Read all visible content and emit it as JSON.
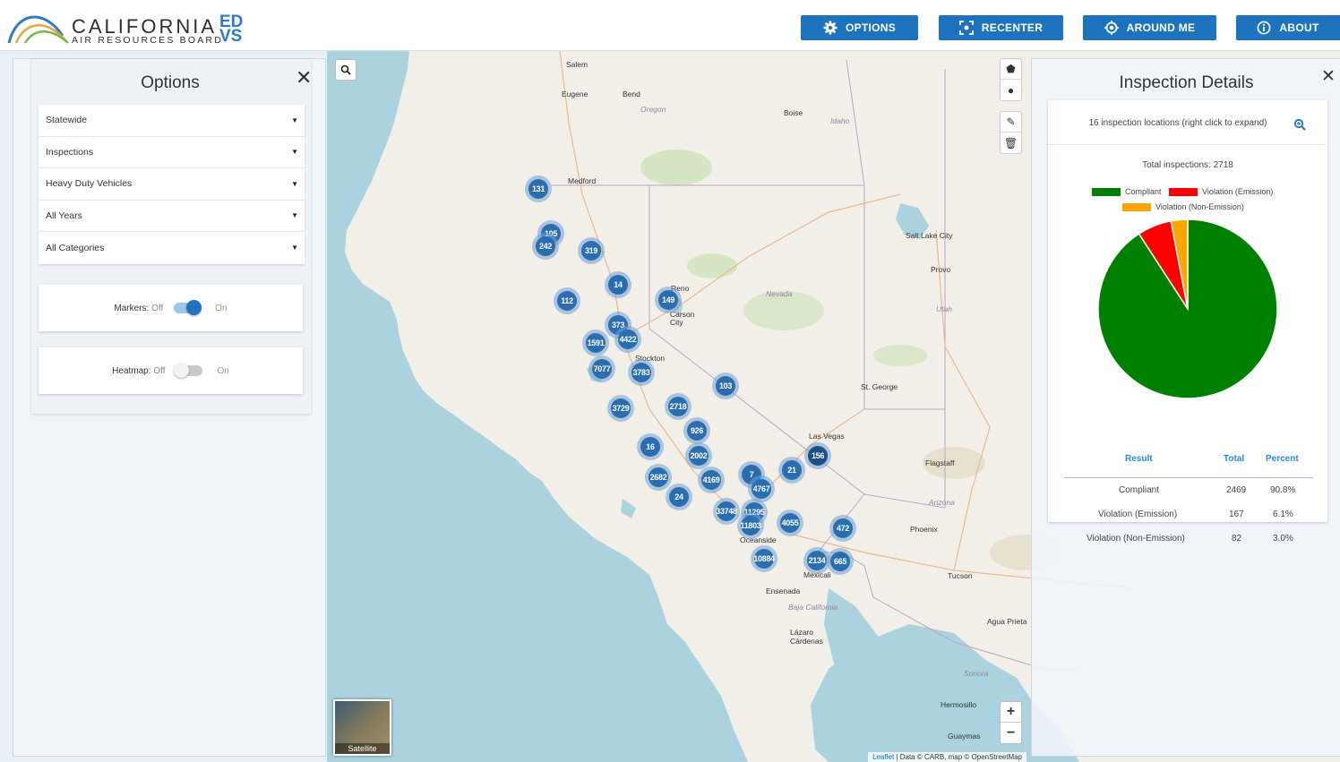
{
  "logo": {
    "main": "CALIFORNIA",
    "sub": "AIR RESOURCES BOARD",
    "edvs": "ED VS"
  },
  "nav": [
    {
      "label": "OPTIONS",
      "icon": "gear-icon"
    },
    {
      "label": "RECENTER",
      "icon": "recenter-icon"
    },
    {
      "label": "AROUND ME",
      "icon": "location-target-icon"
    },
    {
      "label": "ABOUT",
      "icon": "info-icon"
    }
  ],
  "options": {
    "title": "Options",
    "selects": [
      "Statewide",
      "Inspections",
      "Heavy Duty Vehicles",
      "All Years",
      "All Categories"
    ],
    "markers": {
      "label": "Markers:",
      "off": "Off",
      "on": "On",
      "enabled": true
    },
    "heatmap": {
      "label": "Heatmap:",
      "off": "Off",
      "on": "On",
      "enabled": false
    }
  },
  "map": {
    "labels": [
      {
        "text": "Salem"
      },
      {
        "text": "Eugene"
      },
      {
        "text": "Bend"
      },
      {
        "text": "Oregon",
        "state": true
      },
      {
        "text": "Boise"
      },
      {
        "text": "Idaho",
        "state": true
      },
      {
        "text": "Medford"
      },
      {
        "text": "Salt Lake City"
      },
      {
        "text": "Provo"
      },
      {
        "text": "Nevada",
        "state": true
      },
      {
        "text": "Utah",
        "state": true
      },
      {
        "text": "Reno"
      },
      {
        "text": "Carson City"
      },
      {
        "text": "Stockton"
      },
      {
        "text": "St. George"
      },
      {
        "text": "Las Vegas"
      },
      {
        "text": "Flagstaff"
      },
      {
        "text": "Arizona",
        "state": true
      },
      {
        "text": "Phoenix"
      },
      {
        "text": "Tucson"
      },
      {
        "text": "Oceanside"
      },
      {
        "text": "Mexicali"
      },
      {
        "text": "Ensenada"
      },
      {
        "text": "Baja California",
        "state": true
      },
      {
        "text": "Agua Prieta"
      },
      {
        "text": "Lázaro Cárdenas"
      },
      {
        "text": "Sonora",
        "state": true
      },
      {
        "text": "Hermosillo"
      },
      {
        "text": "Guaymas"
      }
    ],
    "clusters": [
      {
        "count": "131"
      },
      {
        "count": "105"
      },
      {
        "count": "242"
      },
      {
        "count": "319"
      },
      {
        "count": "14"
      },
      {
        "count": "149"
      },
      {
        "count": "112"
      },
      {
        "count": "373"
      },
      {
        "count": "4422"
      },
      {
        "count": "1591"
      },
      {
        "count": "7077"
      },
      {
        "count": "3783"
      },
      {
        "count": "103"
      },
      {
        "count": "3729"
      },
      {
        "count": "2718"
      },
      {
        "count": "926"
      },
      {
        "count": "16"
      },
      {
        "count": "2002"
      },
      {
        "count": "156",
        "dark": true
      },
      {
        "count": "21"
      },
      {
        "count": "7"
      },
      {
        "count": "2682"
      },
      {
        "count": "4169"
      },
      {
        "count": "4767"
      },
      {
        "count": "24"
      },
      {
        "count": "33748"
      },
      {
        "count": "11295"
      },
      {
        "count": "11803"
      },
      {
        "count": "4055"
      },
      {
        "count": "472"
      },
      {
        "count": "10884"
      },
      {
        "count": "2134"
      },
      {
        "count": "665"
      }
    ],
    "satellite_label": "Satellite",
    "attribution_leaflet": "Leaflet",
    "attribution_rest": " | Data © CARB, map © OpenStreetMap"
  },
  "inspection": {
    "title": "Inspection Details",
    "locations_text": "16 inspection locations (right click to expand)",
    "total_text": "Total inspections: 2718",
    "legend": [
      {
        "label": "Compliant",
        "color": "#008000"
      },
      {
        "label": "Violation (Emission)",
        "color": "#ff0000"
      },
      {
        "label": "Violation (Non-Emission)",
        "color": "#ffa500"
      }
    ],
    "headers": {
      "result": "Result",
      "total": "Total",
      "percent": "Percent"
    },
    "rows": [
      {
        "result": "Compliant",
        "total": "2469",
        "percent": "90.8%"
      },
      {
        "result": "Violation (Emission)",
        "total": "167",
        "percent": "6.1%"
      },
      {
        "result": "Violation (Non-Emission)",
        "total": "82",
        "percent": "3.0%"
      }
    ]
  },
  "chart_data": {
    "type": "pie",
    "categories": [
      "Compliant",
      "Violation (Emission)",
      "Violation (Non-Emission)"
    ],
    "values": [
      2469,
      167,
      82
    ],
    "colors": [
      "#008000",
      "#ff0000",
      "#ffa500"
    ]
  }
}
